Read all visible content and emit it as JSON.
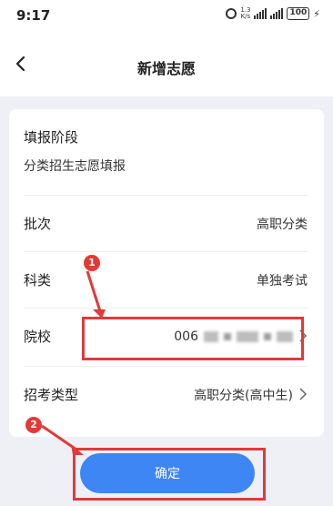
{
  "status_bar": {
    "time": "9:17",
    "network_speed_top": "1.3",
    "network_speed_bottom": "K/s",
    "battery": "100"
  },
  "nav": {
    "title": "新增志愿"
  },
  "form": {
    "stage_title": "填报阶段",
    "stage_value": "分类招生志愿填报",
    "rows": [
      {
        "label": "批次",
        "value": "高职分类"
      },
      {
        "label": "科类",
        "value": "单独考试"
      },
      {
        "label": "院校",
        "value": "006"
      },
      {
        "label": "招考类型",
        "value": "高职分类(高中生)"
      }
    ]
  },
  "annotations": {
    "step1": "1",
    "step2": "2",
    "highlight_color": "#e03a3a"
  },
  "confirm_label": "确定",
  "colors": {
    "accent": "#3f86f5",
    "background": "#eef0f5"
  }
}
